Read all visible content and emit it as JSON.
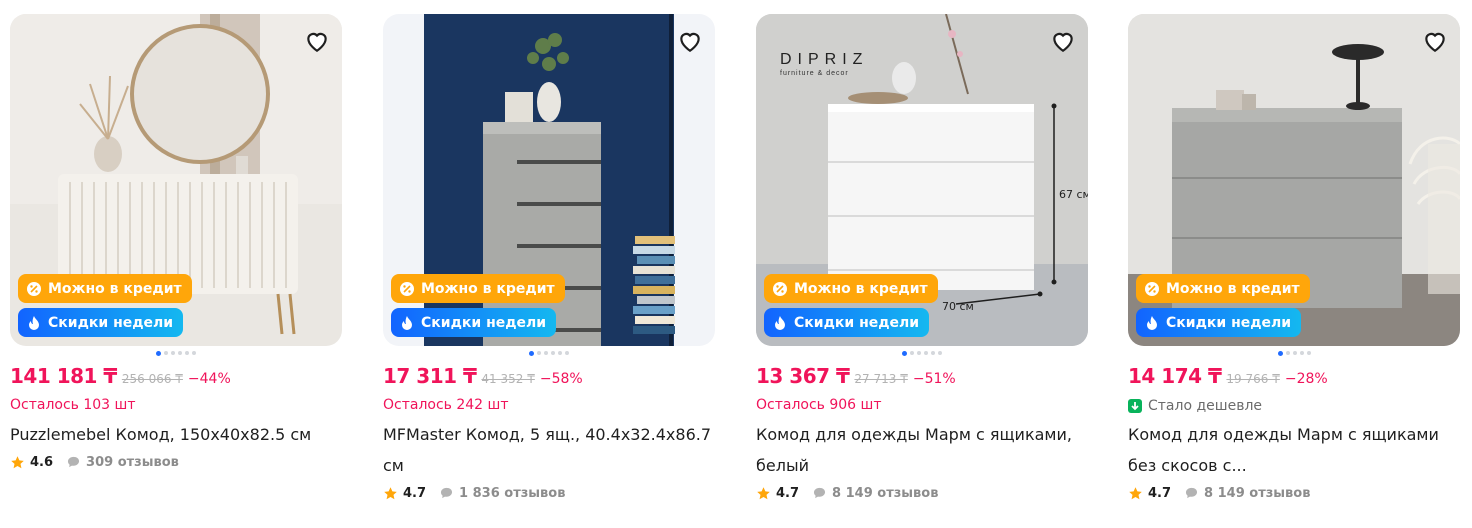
{
  "products": [
    {
      "price": "141 181 ₸",
      "old_price": "256 066 ₸",
      "discount": "−44%",
      "status": "Осталось 103 шт",
      "status_type": "stock",
      "title": "Puzzlemebel Комод, 150x40x82.5 см",
      "rating": "4.6",
      "reviews": "309 отзывов",
      "badge_credit": "Можно в кредит",
      "badge_sale": "Скидки недели",
      "image_bg": "#e9e6e1"
    },
    {
      "price": "17 311 ₸",
      "old_price": "41 352 ₸",
      "discount": "−58%",
      "status": "Осталось 242 шт",
      "status_type": "stock",
      "title": "MFMaster Комод, 5 ящ., 40.4x32.4x86.7 см",
      "rating": "4.7",
      "reviews": "1 836 отзывов",
      "badge_credit": "Можно в кредит",
      "badge_sale": "Скидки недели",
      "image_bg": "#1e3a63"
    },
    {
      "price": "13 367 ₸",
      "old_price": "27 713 ₸",
      "discount": "−51%",
      "status": "Осталось 906 шт",
      "status_type": "stock",
      "title": "Комод для одежды Марм с ящиками, белый",
      "rating": "4.7",
      "reviews": "8 149 отзывов",
      "badge_credit": "Можно в кредит",
      "badge_sale": "Скидки недели",
      "image_bg": "#cfcfcd",
      "image_text": {
        "brand": "DIPRIZ",
        "brand_sub": "furniture & decor",
        "height": "67 см",
        "width": "70 см"
      }
    },
    {
      "price": "14 174 ₸",
      "old_price": "19 766 ₸",
      "discount": "−28%",
      "status": "Стало дешевле",
      "status_type": "cheaper",
      "title": "Комод для одежды Марм с ящиками без скосов с...",
      "rating": "4.7",
      "reviews": "8 149 отзывов",
      "badge_credit": "Можно в кредит",
      "badge_sale": "Скидки недели",
      "image_bg": "#dcdcda"
    }
  ],
  "colors": {
    "price": "#f0145a",
    "credit_badge": "#ffa60a",
    "sale_badge_from": "#1264ff",
    "sale_badge_to": "#14b8f0",
    "star": "#ffa60a",
    "cheaper_icon": "#08b35b"
  },
  "icons": {
    "favorite": "heart-outline-icon",
    "credit": "percent-icon",
    "sale": "flame-icon",
    "rating": "star-icon",
    "reviews": "speech-bubble-icon",
    "cheaper": "arrow-down-icon"
  }
}
